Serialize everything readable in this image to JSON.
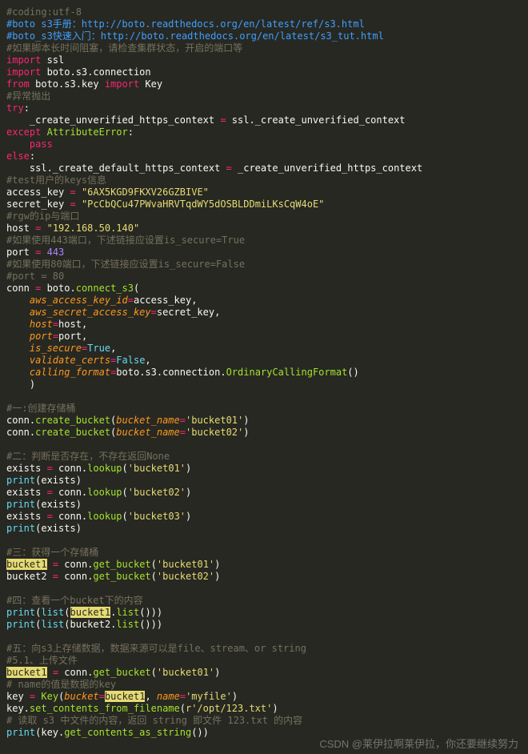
{
  "watermark": "CSDN @莱伊拉啊莱伊拉，你还要继续努力",
  "lines": [
    [
      [
        "c",
        "#coding:utf-8"
      ]
    ],
    [
      [
        "cb",
        "#boto s3手册：http://boto.readthedocs.org/en/latest/ref/s3.html"
      ]
    ],
    [
      [
        "cb",
        "#boto_s3快速入门：http://boto.readthedocs.org/en/latest/s3_tut.html"
      ]
    ],
    [
      [
        "c",
        "#如果脚本长时间阻塞，请检查集群状态，开启的端口等"
      ]
    ],
    [
      [
        "kw",
        "import"
      ],
      [
        "n",
        " ssl"
      ]
    ],
    [
      [
        "kw",
        "import"
      ],
      [
        "n",
        " boto.s3.connection"
      ]
    ],
    [
      [
        "kw",
        "from"
      ],
      [
        "n",
        " boto.s3.key "
      ],
      [
        "kw",
        "import"
      ],
      [
        "n",
        " Key"
      ]
    ],
    [
      [
        "c",
        "#异常抛出"
      ]
    ],
    [
      [
        "kw",
        "try"
      ],
      [
        "n",
        ":"
      ]
    ],
    [
      [
        "n",
        "    _create_unverified_https_context "
      ],
      [
        "kw",
        "="
      ],
      [
        "n",
        " ssl._create_unverified_context"
      ]
    ],
    [
      [
        "kw",
        "except"
      ],
      [
        "n",
        " "
      ],
      [
        "fn",
        "AttributeError"
      ],
      [
        "n",
        ":"
      ]
    ],
    [
      [
        "n",
        "    "
      ],
      [
        "kw",
        "pass"
      ]
    ],
    [
      [
        "kw",
        "else"
      ],
      [
        "n",
        ":"
      ]
    ],
    [
      [
        "n",
        "    ssl._create_default_https_context "
      ],
      [
        "kw",
        "="
      ],
      [
        "n",
        " _create_unverified_https_context"
      ]
    ],
    [
      [
        "c",
        "#test用户的keys信息"
      ]
    ],
    [
      [
        "n",
        "access_key "
      ],
      [
        "kw",
        "="
      ],
      [
        "n",
        " "
      ],
      [
        "s",
        "\"6AX5KGD9FKXV26GZBIVE\""
      ]
    ],
    [
      [
        "n",
        "secret_key "
      ],
      [
        "kw",
        "="
      ],
      [
        "n",
        " "
      ],
      [
        "s",
        "\"PcCbQCu47PWvaHRVTqdWY5dOSBLDDmiLKsCqW4oE\""
      ]
    ],
    [
      [
        "c",
        "#rgw的ip与端口"
      ]
    ],
    [
      [
        "n",
        "host "
      ],
      [
        "kw",
        "="
      ],
      [
        "n",
        " "
      ],
      [
        "s",
        "\"192.168.50.140\""
      ]
    ],
    [
      [
        "c",
        "#如果使用443端口，下述链接应设置is_secure=True"
      ]
    ],
    [
      [
        "n",
        "port "
      ],
      [
        "kw",
        "="
      ],
      [
        "n",
        " "
      ],
      [
        "num",
        "443"
      ]
    ],
    [
      [
        "c",
        "#如果使用80端口，下述链接应设置is_secure=False"
      ]
    ],
    [
      [
        "c",
        "#port = 80"
      ]
    ],
    [
      [
        "n",
        "conn "
      ],
      [
        "kw",
        "="
      ],
      [
        "n",
        " boto."
      ],
      [
        "fn",
        "connect_s3"
      ],
      [
        "n",
        "("
      ]
    ],
    [
      [
        "n",
        "    "
      ],
      [
        "arg",
        "aws_access_key_id"
      ],
      [
        "kw",
        "="
      ],
      [
        "n",
        "access_key,"
      ]
    ],
    [
      [
        "n",
        "    "
      ],
      [
        "arg",
        "aws_secret_access_key"
      ],
      [
        "kw",
        "="
      ],
      [
        "n",
        "secret_key,"
      ]
    ],
    [
      [
        "n",
        "    "
      ],
      [
        "arg",
        "host"
      ],
      [
        "kw",
        "="
      ],
      [
        "n",
        "host,"
      ]
    ],
    [
      [
        "n",
        "    "
      ],
      [
        "arg",
        "port"
      ],
      [
        "kw",
        "="
      ],
      [
        "n",
        "port,"
      ]
    ],
    [
      [
        "n",
        "    "
      ],
      [
        "arg",
        "is_secure"
      ],
      [
        "kw",
        "="
      ],
      [
        "bi",
        "True"
      ],
      [
        "n",
        ","
      ]
    ],
    [
      [
        "n",
        "    "
      ],
      [
        "arg",
        "validate_certs"
      ],
      [
        "kw",
        "="
      ],
      [
        "bi",
        "False"
      ],
      [
        "n",
        ","
      ]
    ],
    [
      [
        "n",
        "    "
      ],
      [
        "arg",
        "calling_format"
      ],
      [
        "kw",
        "="
      ],
      [
        "n",
        "boto.s3.connection."
      ],
      [
        "fn",
        "OrdinaryCallingFormat"
      ],
      [
        "n",
        "()"
      ]
    ],
    [
      [
        "n",
        "    )"
      ]
    ],
    [
      [
        "n",
        ""
      ]
    ],
    [
      [
        "c",
        "#一:创建存储桶"
      ]
    ],
    [
      [
        "n",
        "conn."
      ],
      [
        "fn",
        "create_bucket"
      ],
      [
        "n",
        "("
      ],
      [
        "arg",
        "bucket_name"
      ],
      [
        "kw",
        "="
      ],
      [
        "s",
        "'bucket01'"
      ],
      [
        "n",
        ")"
      ]
    ],
    [
      [
        "n",
        "conn."
      ],
      [
        "fn",
        "create_bucket"
      ],
      [
        "n",
        "("
      ],
      [
        "arg",
        "bucket_name"
      ],
      [
        "kw",
        "="
      ],
      [
        "s",
        "'bucket02'"
      ],
      [
        "n",
        ")"
      ]
    ],
    [
      [
        "n",
        ""
      ]
    ],
    [
      [
        "c",
        "#二：判断是否存在，不存在返回None"
      ]
    ],
    [
      [
        "n",
        "exists "
      ],
      [
        "kw",
        "="
      ],
      [
        "n",
        " conn."
      ],
      [
        "fn",
        "lookup"
      ],
      [
        "n",
        "("
      ],
      [
        "s",
        "'bucket01'"
      ],
      [
        "n",
        ")"
      ]
    ],
    [
      [
        "bi",
        "print"
      ],
      [
        "n",
        "(exists)"
      ]
    ],
    [
      [
        "n",
        "exists "
      ],
      [
        "kw",
        "="
      ],
      [
        "n",
        " conn."
      ],
      [
        "fn",
        "lookup"
      ],
      [
        "n",
        "("
      ],
      [
        "s",
        "'bucket02'"
      ],
      [
        "n",
        ")"
      ]
    ],
    [
      [
        "bi",
        "print"
      ],
      [
        "n",
        "(exists)"
      ]
    ],
    [
      [
        "n",
        "exists "
      ],
      [
        "kw",
        "="
      ],
      [
        "n",
        " conn."
      ],
      [
        "fn",
        "lookup"
      ],
      [
        "n",
        "("
      ],
      [
        "s",
        "'bucket03'"
      ],
      [
        "n",
        ")"
      ]
    ],
    [
      [
        "bi",
        "print"
      ],
      [
        "n",
        "(exists)"
      ]
    ],
    [
      [
        "n",
        ""
      ]
    ],
    [
      [
        "c",
        "#三：获得一个存储桶"
      ]
    ],
    [
      [
        "hl",
        "bucket1"
      ],
      [
        "n",
        " "
      ],
      [
        "kw",
        "="
      ],
      [
        "n",
        " conn."
      ],
      [
        "fn",
        "get_bucket"
      ],
      [
        "n",
        "("
      ],
      [
        "s",
        "'bucket01'"
      ],
      [
        "n",
        ")"
      ]
    ],
    [
      [
        "n",
        "bucket2 "
      ],
      [
        "kw",
        "="
      ],
      [
        "n",
        " conn."
      ],
      [
        "fn",
        "get_bucket"
      ],
      [
        "n",
        "("
      ],
      [
        "s",
        "'bucket02'"
      ],
      [
        "n",
        ")"
      ]
    ],
    [
      [
        "n",
        ""
      ]
    ],
    [
      [
        "c",
        "#四：查看一个bucket下的内容"
      ]
    ],
    [
      [
        "bi",
        "print"
      ],
      [
        "n",
        "("
      ],
      [
        "bi",
        "list"
      ],
      [
        "n",
        "("
      ],
      [
        "hl",
        "bucket1"
      ],
      [
        "n",
        "."
      ],
      [
        "fn",
        "list"
      ],
      [
        "n",
        "()))"
      ]
    ],
    [
      [
        "bi",
        "print"
      ],
      [
        "n",
        "("
      ],
      [
        "bi",
        "list"
      ],
      [
        "n",
        "(bucket2."
      ],
      [
        "fn",
        "list"
      ],
      [
        "n",
        "()))"
      ]
    ],
    [
      [
        "n",
        ""
      ]
    ],
    [
      [
        "c",
        "#五：向s3上存储数据，数据来源可以是file、stream、or string"
      ]
    ],
    [
      [
        "c",
        "#5.1、上传文件"
      ]
    ],
    [
      [
        "hl",
        "bucket1"
      ],
      [
        "n",
        " "
      ],
      [
        "kw",
        "="
      ],
      [
        "n",
        " conn."
      ],
      [
        "fn",
        "get_bucket"
      ],
      [
        "n",
        "("
      ],
      [
        "s",
        "'bucket01'"
      ],
      [
        "n",
        ")"
      ]
    ],
    [
      [
        "c",
        "# name的值是数据的key"
      ]
    ],
    [
      [
        "n",
        "key "
      ],
      [
        "kw",
        "="
      ],
      [
        "n",
        " "
      ],
      [
        "fn",
        "Key"
      ],
      [
        "n",
        "("
      ],
      [
        "arg",
        "bucket"
      ],
      [
        "kw",
        "="
      ],
      [
        "hl",
        "bucket1"
      ],
      [
        "n",
        ", "
      ],
      [
        "arg",
        "name"
      ],
      [
        "kw",
        "="
      ],
      [
        "s",
        "'myfile'"
      ],
      [
        "n",
        ")"
      ]
    ],
    [
      [
        "n",
        "key."
      ],
      [
        "fn",
        "set_contents_from_filename"
      ],
      [
        "n",
        "("
      ],
      [
        "s",
        "r'/opt/123.txt'"
      ],
      [
        "n",
        ")"
      ]
    ],
    [
      [
        "c",
        "# 读取 s3 中文件的内容，返回 string 即文件 123.txt 的内容"
      ]
    ],
    [
      [
        "bi",
        "print"
      ],
      [
        "n",
        "(key."
      ],
      [
        "fn",
        "get_contents_as_string"
      ],
      [
        "n",
        "())"
      ]
    ]
  ]
}
